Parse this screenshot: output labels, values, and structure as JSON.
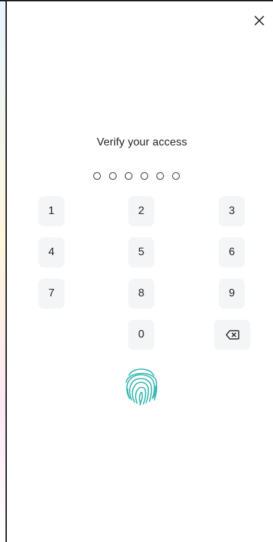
{
  "title": "Verify your access",
  "pin_length": 6,
  "keypad": {
    "k1": "1",
    "k2": "2",
    "k3": "3",
    "k4": "4",
    "k5": "5",
    "k6": "6",
    "k7": "7",
    "k8": "8",
    "k9": "9",
    "k0": "0"
  },
  "icons": {
    "close": "close-icon",
    "backspace": "backspace-icon",
    "fingerprint": "fingerprint-icon"
  },
  "colors": {
    "accent": "#2bb3ad",
    "key_bg": "#f4f5f7",
    "text": "#222222"
  }
}
